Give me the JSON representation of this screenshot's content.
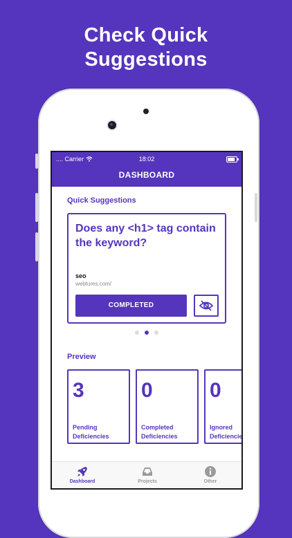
{
  "headline": {
    "line1": "Check Quick",
    "line2": "Suggestions"
  },
  "status_bar": {
    "carrier": ".... Carrier",
    "time": "18:02"
  },
  "nav": {
    "title": "DASHBOARD"
  },
  "quick_suggestions": {
    "label": "Quick Suggestions",
    "card": {
      "question": "Does any <h1> tag contain the keyword?",
      "keyword": "seo",
      "url": "webtures.com/",
      "complete_label": "COMPLETED",
      "hide_icon": "eye-off-icon"
    },
    "pager": {
      "count": 3,
      "active": 1
    }
  },
  "preview": {
    "label": "Preview",
    "tiles": [
      {
        "value": "3",
        "label": "Pending Deficiencies"
      },
      {
        "value": "0",
        "label": "Completed Deficiencies"
      },
      {
        "value": "0",
        "label": "Ignored Deficiencies"
      }
    ]
  },
  "tabbar": {
    "items": [
      {
        "label": "Dashboard",
        "icon": "rocket-icon",
        "active": true
      },
      {
        "label": "Projects",
        "icon": "inbox-icon",
        "active": false
      },
      {
        "label": "Other",
        "icon": "info-icon",
        "active": false
      }
    ]
  },
  "colors": {
    "accent": "#5535bd",
    "inactive_tab": "#9a9a9a"
  }
}
